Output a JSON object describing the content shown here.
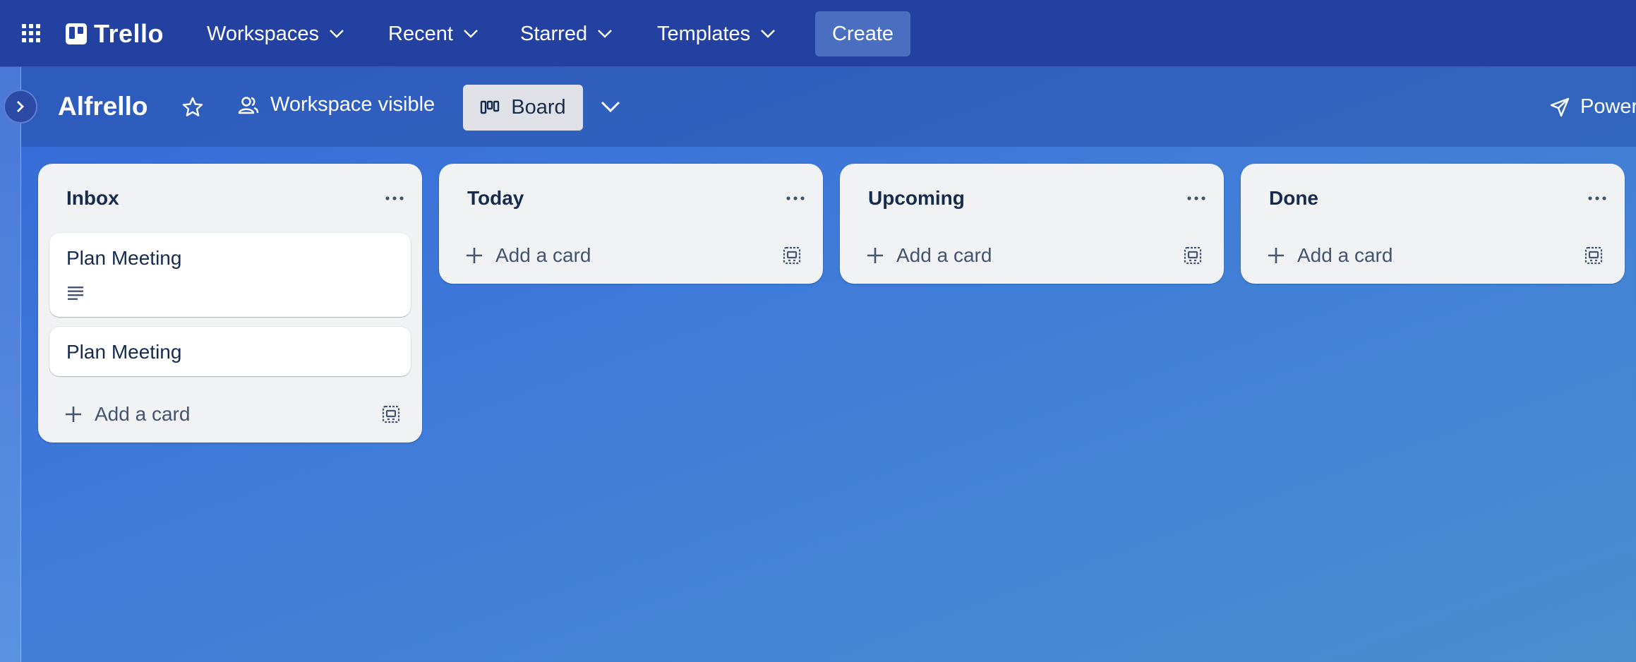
{
  "nav": {
    "logo_text": "Trello",
    "workspaces": "Workspaces",
    "recent": "Recent",
    "starred": "Starred",
    "templates": "Templates",
    "create": "Create"
  },
  "board": {
    "title": "Alfrello",
    "visibility": "Workspace visible",
    "view": "Board",
    "powerups": "Power"
  },
  "lists": [
    {
      "title": "Inbox",
      "cards": [
        {
          "title": "Plan Meeting",
          "has_description": true
        },
        {
          "title": "Plan Meeting",
          "has_description": false
        }
      ],
      "add_label": "Add a card"
    },
    {
      "title": "Today",
      "cards": [],
      "add_label": "Add a card"
    },
    {
      "title": "Upcoming",
      "cards": [],
      "add_label": "Add a card"
    },
    {
      "title": "Done",
      "cards": [],
      "add_label": "Add a card"
    }
  ],
  "colors": {
    "topbar": "#2341a0",
    "list_bg": "#f1f2f4",
    "create_button": "#4a6fc0"
  }
}
